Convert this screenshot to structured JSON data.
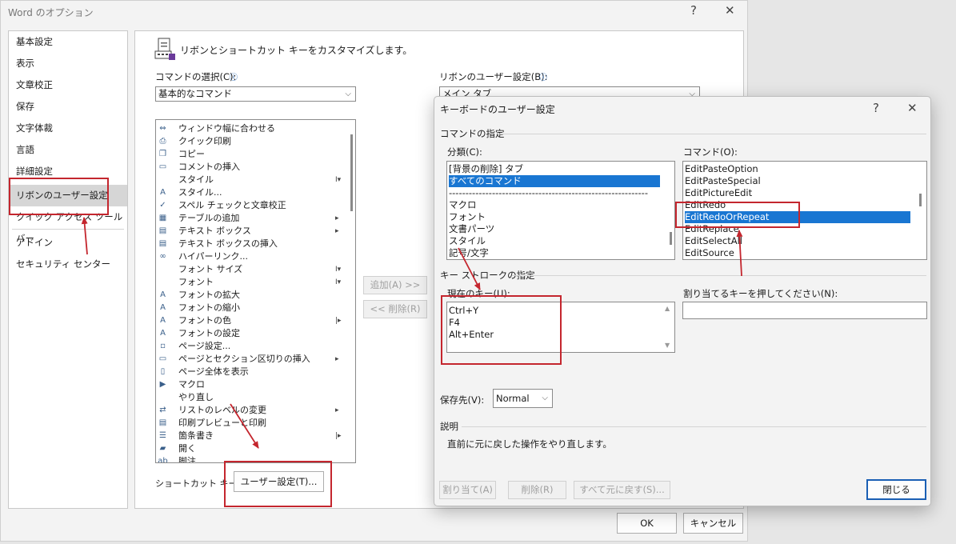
{
  "window": {
    "title": "Word のオプション",
    "help": "?",
    "close": "✕"
  },
  "nav": {
    "items": [
      "基本設定",
      "表示",
      "文章校正",
      "保存",
      "文字体裁",
      "言語",
      "詳細設定",
      "リボンのユーザー設定",
      "クイック アクセス ツール バー",
      "アドイン",
      "セキュリティ センター"
    ],
    "selected": "リボンのユーザー設定"
  },
  "main": {
    "header": "リボンとショートカット キーをカスタマイズします。",
    "choose_label": "コマンドの選択(C):",
    "choose_value": "基本的なコマンド",
    "ribbon_label": "リボンのユーザー設定(B):",
    "ribbon_value": "メイン タブ",
    "commands": [
      {
        "label": "ウィンドウ幅に合わせる",
        "icon": "⇔"
      },
      {
        "label": "クイック印刷",
        "icon": "⎙"
      },
      {
        "label": "コピー",
        "icon": "❐"
      },
      {
        "label": "コメントの挿入",
        "icon": "▭"
      },
      {
        "label": "スタイル",
        "icon": "",
        "sub": "I▾"
      },
      {
        "label": "スタイル...",
        "icon": "A"
      },
      {
        "label": "スペル チェックと文章校正",
        "icon": "✓"
      },
      {
        "label": "テーブルの追加",
        "icon": "▦",
        "sub": "▸"
      },
      {
        "label": "テキスト ボックス",
        "icon": "▤",
        "sub": "▸"
      },
      {
        "label": "テキスト ボックスの挿入",
        "icon": "▤"
      },
      {
        "label": "ハイパーリンク...",
        "icon": "∞"
      },
      {
        "label": "フォント サイズ",
        "icon": "",
        "sub": "I▾"
      },
      {
        "label": "フォント",
        "icon": "",
        "sub": "I▾"
      },
      {
        "label": "フォントの拡大",
        "icon": "A"
      },
      {
        "label": "フォントの縮小",
        "icon": "A"
      },
      {
        "label": "フォントの色",
        "icon": "A",
        "sub": "|▸"
      },
      {
        "label": "フォントの設定",
        "icon": "A"
      },
      {
        "label": "ページ設定...",
        "icon": "▫"
      },
      {
        "label": "ページとセクション区切りの挿入",
        "icon": "▭",
        "sub": "▸"
      },
      {
        "label": "ページ全体を表示",
        "icon": "▯"
      },
      {
        "label": "マクロ",
        "icon": "▶"
      },
      {
        "label": "やり直し",
        "icon": ""
      },
      {
        "label": "リストのレベルの変更",
        "icon": "⇄",
        "sub": "▸"
      },
      {
        "label": "印刷プレビューと印刷",
        "icon": "▤"
      },
      {
        "label": "箇条書き",
        "icon": "☰",
        "sub": "|▸"
      },
      {
        "label": "開く",
        "icon": "▰"
      },
      {
        "label": "脚注",
        "icon": "ab"
      }
    ],
    "add_button": "追加(A) >>",
    "remove_button": "<< 削除(R)",
    "shortcut_label": "ショートカット キー:",
    "customize_button": "ユーザー設定(T)..."
  },
  "footer": {
    "ok": "OK",
    "cancel": "キャンセル"
  },
  "keyboard_dialog": {
    "title": "キーボードのユーザー設定",
    "help": "?",
    "close": "✕",
    "commands_group": "コマンドの指定",
    "category_label": "分類(C):",
    "categories": [
      "[背景の削除] タブ",
      "すべてのコマンド",
      "------------------------------------------------------------",
      "マクロ",
      "フォント",
      "文書パーツ",
      "スタイル",
      "記号/文字"
    ],
    "category_selected": "すべてのコマンド",
    "command_label": "コマンド(O):",
    "commands": [
      "EditPasteOption",
      "EditPasteSpecial",
      "EditPictureEdit",
      "EditRedo",
      "EditRedoOrRepeat",
      "EditReplace",
      "EditSelectAll",
      "EditSource"
    ],
    "command_selected": "EditRedoOrRepeat",
    "keystroke_group": "キー ストロークの指定",
    "current_keys_label": "現在のキー(U):",
    "current_keys": [
      "Ctrl+Y",
      "F4",
      "Alt+Enter"
    ],
    "new_key_label": "割り当てるキーを押してください(N):",
    "new_key_value": "",
    "save_in_label": "保存先(V):",
    "save_in_value": "Normal",
    "description_group": "説明",
    "description": "直前に元に戻した操作をやり直します。",
    "assign_button": "割り当て(A)",
    "remove_button": "削除(R)",
    "reset_all_button": "すべて元に戻す(S)...",
    "close_button": "閉じる"
  },
  "annotation_color": "#c4262e",
  "selection_color": "#1976d2"
}
